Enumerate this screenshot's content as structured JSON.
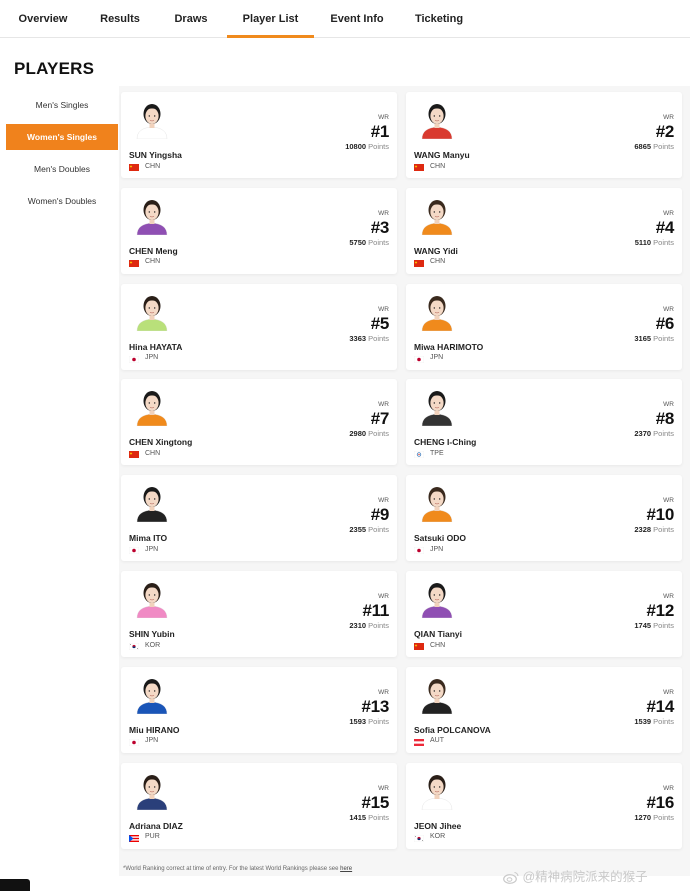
{
  "nav": {
    "tabs": [
      {
        "label": "Overview"
      },
      {
        "label": "Results"
      },
      {
        "label": "Draws"
      },
      {
        "label": "Player List"
      },
      {
        "label": "Event Info"
      },
      {
        "label": "Ticketing"
      }
    ],
    "active": "Player List"
  },
  "page": {
    "title": "PLAYERS"
  },
  "sidebar": {
    "items": [
      {
        "label": "Men's Singles"
      },
      {
        "label": "Women's Singles"
      },
      {
        "label": "Men's Doubles"
      },
      {
        "label": "Women's Doubles"
      }
    ],
    "active": "Women's Singles",
    "accent": "#f0821c"
  },
  "ranking_label": "WR",
  "points_unit": "Points",
  "players": [
    {
      "name": "SUN Yingsha",
      "country": "CHN",
      "rank": "#1",
      "points": "10800"
    },
    {
      "name": "WANG Manyu",
      "country": "CHN",
      "rank": "#2",
      "points": "6865"
    },
    {
      "name": "CHEN Meng",
      "country": "CHN",
      "rank": "#3",
      "points": "5750"
    },
    {
      "name": "WANG Yidi",
      "country": "CHN",
      "rank": "#4",
      "points": "5110"
    },
    {
      "name": "Hina HAYATA",
      "country": "JPN",
      "rank": "#5",
      "points": "3363"
    },
    {
      "name": "Miwa HARIMOTO",
      "country": "JPN",
      "rank": "#6",
      "points": "3165"
    },
    {
      "name": "CHEN Xingtong",
      "country": "CHN",
      "rank": "#7",
      "points": "2980"
    },
    {
      "name": "CHENG I-Ching",
      "country": "TPE",
      "rank": "#8",
      "points": "2370"
    },
    {
      "name": "Mima ITO",
      "country": "JPN",
      "rank": "#9",
      "points": "2355"
    },
    {
      "name": "Satsuki ODO",
      "country": "JPN",
      "rank": "#10",
      "points": "2328"
    },
    {
      "name": "SHIN Yubin",
      "country": "KOR",
      "rank": "#11",
      "points": "2310"
    },
    {
      "name": "QIAN Tianyi",
      "country": "CHN",
      "rank": "#12",
      "points": "1745"
    },
    {
      "name": "Miu HIRANO",
      "country": "JPN",
      "rank": "#13",
      "points": "1593"
    },
    {
      "name": "Sofia POLCANOVA",
      "country": "AUT",
      "rank": "#14",
      "points": "1539"
    },
    {
      "name": "Adriana DIAZ",
      "country": "PUR",
      "rank": "#15",
      "points": "1415"
    },
    {
      "name": "JEON Jihee",
      "country": "KOR",
      "rank": "#16",
      "points": "1270"
    }
  ],
  "footnote": {
    "text": "*World Ranking correct at time of entry. For the latest World Rankings please see ",
    "link": "here"
  },
  "watermark": "@精神病院派来的猴子"
}
